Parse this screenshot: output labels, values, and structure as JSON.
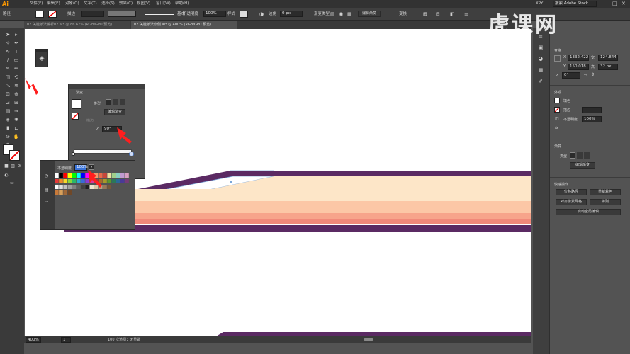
{
  "app": {
    "logo": "Ai",
    "workspace": "XPY",
    "search_placeholder": "搜索 Adobe Stock"
  },
  "menus": [
    "文件(F)",
    "编辑(E)",
    "对象(O)",
    "文字(T)",
    "选择(S)",
    "效果(C)",
    "视图(V)",
    "窗口(W)",
    "帮助(H)"
  ],
  "controlbar": {
    "path_label": "路径",
    "stroke_label": "描边",
    "stroke_profile": "基本",
    "opacity_label": "不透明度",
    "opacity_value": "100%",
    "style_label": "样式",
    "corner_label": "边角",
    "corner_value": "0 px",
    "gradient_type_label": "渐变类型",
    "edit_gradient_btn": "编辑渐变",
    "transform_label": "变换"
  },
  "tabs": [
    {
      "label": "02 关键按法解析02.ai* @ 86.67% (RGB/GPU 预览)"
    },
    {
      "label": "02 关键按法案例.ai* @ 400% (RGB/GPU 预览)"
    }
  ],
  "status": {
    "zoom": "400%",
    "page": "1",
    "info": "100 次渲测；无重做"
  },
  "properties": {
    "transform_title": "变换",
    "x_label": "X",
    "x_value": "1332.422",
    "y_label": "Y",
    "y_value": "150.018",
    "w_label": "宽",
    "w_value": "124.844",
    "h_label": "高",
    "h_value": "32 px",
    "angle_value": "0°",
    "appearance_title": "外观",
    "fill_label": "填色",
    "stroke_label": "描边",
    "opacity_label": "不透明度",
    "opacity_value": "100%",
    "fx_label": "fx",
    "gradient_title": "渐变",
    "type_label": "类型",
    "edit_gradient_btn": "编辑渐变",
    "quick_actions_title": "快速操作",
    "btn_offset_path": "位移路径",
    "btn_recolor": "重新着色",
    "btn_align_pixel": "对齐像素网格",
    "btn_arrange": "排列",
    "btn_global_edit": "启动全局编辑"
  },
  "gradient_panel": {
    "title": "渐变",
    "type_label": "类型",
    "edit_btn": "编辑渐变",
    "angle_value": "90°",
    "stroke_label": "描边"
  },
  "swatch_panel": {
    "opacity_label": "不透明度",
    "opacity_value": "100%"
  },
  "watermark": {
    "text": "虎课网"
  },
  "colors": {
    "purple": "#5b2a63",
    "peach_light": "#fde6c8",
    "peach": "#fcc7a6",
    "salmon": "#f7a48b",
    "coral": "#f1897a",
    "arrow_red": "#ff1e1e"
  }
}
